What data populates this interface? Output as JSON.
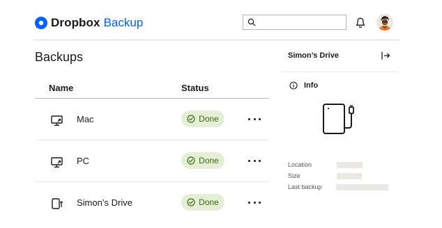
{
  "header": {
    "brand_name": "Dropbox",
    "brand_suffix": "Backup",
    "search_placeholder": "",
    "search_value": "",
    "colors": {
      "brand": "#0061fe"
    }
  },
  "main": {
    "title": "Backups",
    "columns": {
      "name": "Name",
      "status": "Status"
    },
    "rows": [
      {
        "name": "Mac",
        "status": "Done",
        "icon": "computer-upload-icon"
      },
      {
        "name": "PC",
        "status": "Done",
        "icon": "computer-upload-icon"
      },
      {
        "name": "Simon’s Drive",
        "status": "Done",
        "icon": "external-drive-upload-icon"
      }
    ],
    "colors": {
      "status_done_bg": "#e4efd6",
      "status_done_fg": "#3e6b12"
    }
  },
  "details": {
    "title": "Simon’s Drive",
    "section_label": "Info",
    "fields": [
      {
        "label": "Location"
      },
      {
        "label": "Size"
      },
      {
        "label": "Last backup"
      }
    ]
  }
}
